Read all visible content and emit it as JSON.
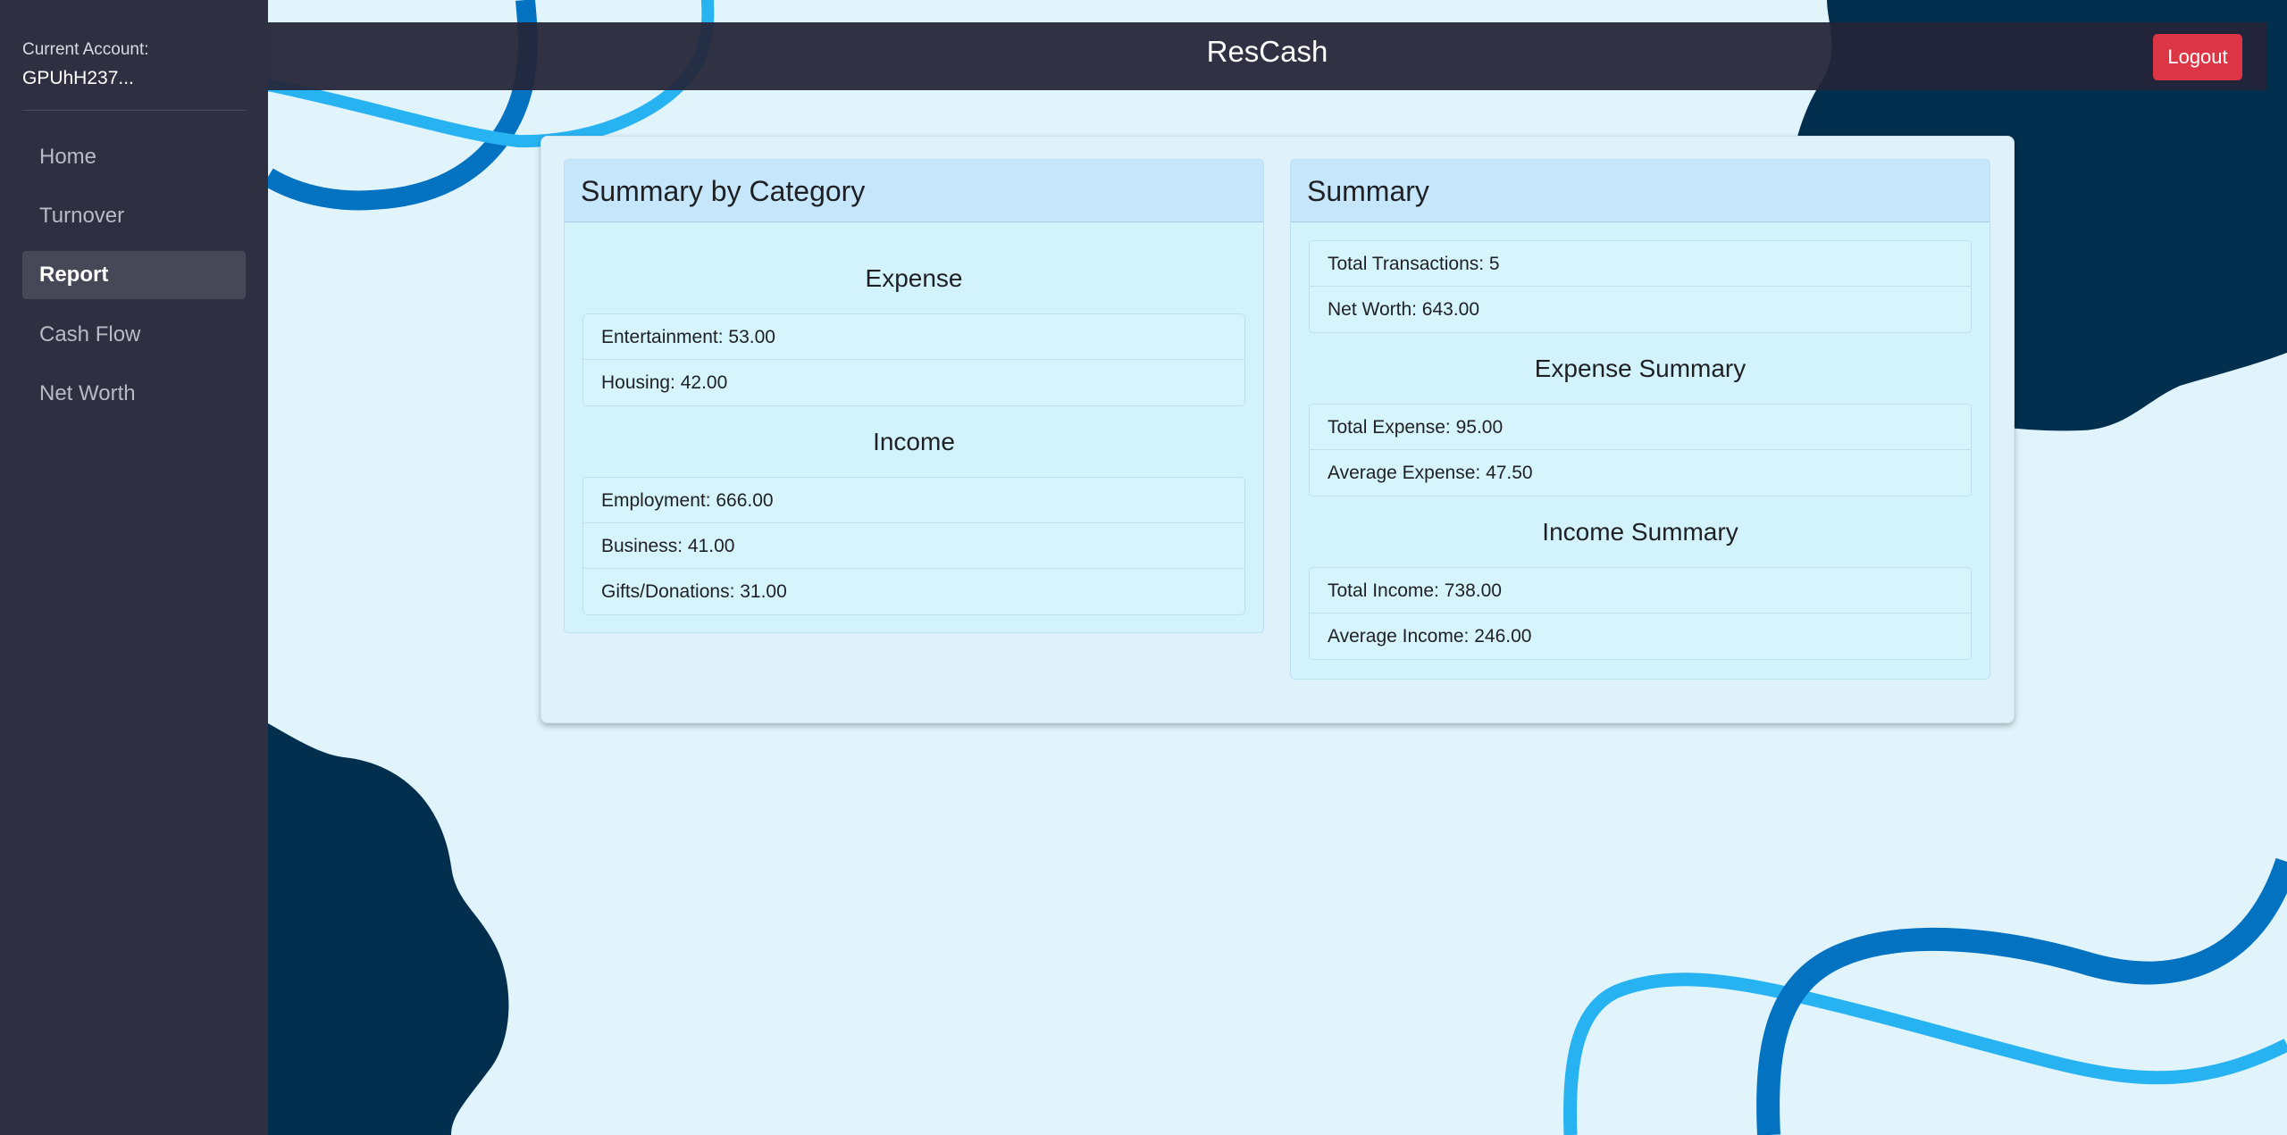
{
  "account": {
    "label": "Current Account:",
    "id": "GPUhH237..."
  },
  "nav": {
    "items": [
      {
        "label": "Home"
      },
      {
        "label": "Turnover"
      },
      {
        "label": "Report"
      },
      {
        "label": "Cash Flow"
      },
      {
        "label": "Net Worth"
      }
    ],
    "active": "Report"
  },
  "header": {
    "title": "ResCash",
    "logout_label": "Logout"
  },
  "category_summary": {
    "title": "Summary by Category",
    "expense": {
      "title": "Expense",
      "items": [
        "Entertainment: 53.00",
        "Housing: 42.00"
      ]
    },
    "income": {
      "title": "Income",
      "items": [
        "Employment: 666.00",
        "Business: 41.00",
        "Gifts/Donations: 31.00"
      ]
    }
  },
  "summary": {
    "title": "Summary",
    "general": [
      "Total Transactions: 5",
      "Net Worth: 643.00"
    ],
    "expense": {
      "title": "Expense Summary",
      "items": [
        "Total Expense: 95.00",
        "Average Expense: 47.50"
      ]
    },
    "income": {
      "title": "Income Summary",
      "items": [
        "Total Income: 738.00",
        "Average Income: 246.00"
      ]
    }
  },
  "colors": {
    "background": "#e1f4fc",
    "sidebar": "#2f2f42",
    "topbar": "#242538",
    "logout": "#dc3545",
    "dark_blob": "#012f4d",
    "wave_mid": "#0372c1",
    "wave_light": "#27b3f2"
  }
}
